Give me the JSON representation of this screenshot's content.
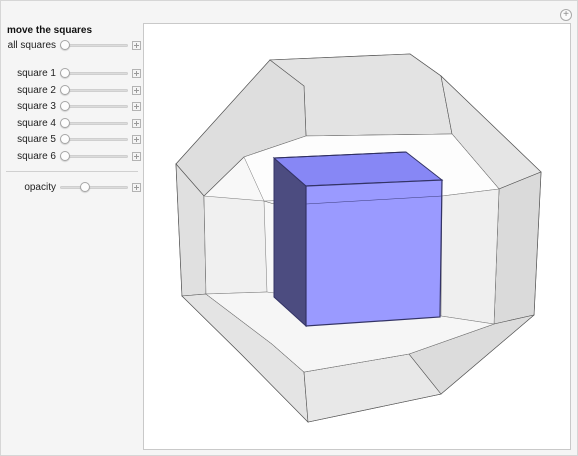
{
  "panel": {
    "title": "move the squares",
    "all_squares": {
      "label": "all squares",
      "value": 0.0
    },
    "squares": [
      {
        "label": "square 1",
        "value": 0.0
      },
      {
        "label": "square 2",
        "value": 0.0
      },
      {
        "label": "square 3",
        "value": 0.0
      },
      {
        "label": "square 4",
        "value": 0.0
      },
      {
        "label": "square 5",
        "value": 0.0
      },
      {
        "label": "square 6",
        "value": 0.0
      }
    ],
    "opacity": {
      "label": "opacity",
      "value": 0.35
    }
  },
  "colors": {
    "cube_front": "#9a9aff",
    "cube_top": "#7f7ff0",
    "cube_side": "#4c4c80",
    "edge": "#333366",
    "polyhedron_face": "#e8e8e8",
    "polyhedron_edge": "#555555"
  },
  "icons": {
    "reset": "plus-circle-icon",
    "slider_add": "plus-square-icon"
  }
}
